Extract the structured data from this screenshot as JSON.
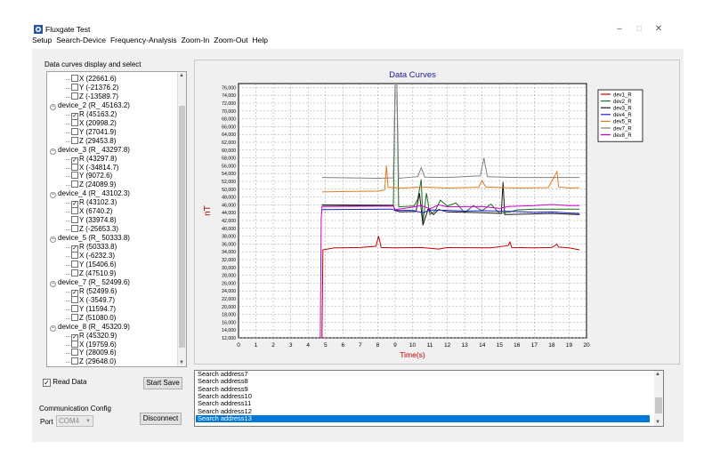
{
  "window": {
    "title": "Fluxgate Test"
  },
  "menu": [
    "Setup",
    "Search-Device",
    "Frequency-Analysis",
    "Zoom-In",
    "Zoom-Out",
    "Help"
  ],
  "tree_group_label": "Data curves display and select",
  "tree": [
    {
      "type": "leaf",
      "text": "X (22661.6)",
      "checked": false
    },
    {
      "type": "leaf",
      "text": "Y (-21376.2)",
      "checked": false
    },
    {
      "type": "leaf",
      "text": "Z (-13589.7)",
      "checked": false
    },
    {
      "type": "device",
      "text": "device_2  (R_ 45163.2)"
    },
    {
      "type": "leaf",
      "text": "R (45163.2)",
      "checked": true
    },
    {
      "type": "leaf",
      "text": "X (20998.2)",
      "checked": false
    },
    {
      "type": "leaf",
      "text": "Y (27041.9)",
      "checked": false
    },
    {
      "type": "leaf",
      "text": "Z (29453.8)",
      "checked": false
    },
    {
      "type": "device",
      "text": "device_3  (R_ 43297.8)"
    },
    {
      "type": "leaf",
      "text": "R (43297.8)",
      "checked": true
    },
    {
      "type": "leaf",
      "text": "X (-34814.7)",
      "checked": false
    },
    {
      "type": "leaf",
      "text": "Y (9072.6)",
      "checked": false
    },
    {
      "type": "leaf",
      "text": "Z (24089.9)",
      "checked": false
    },
    {
      "type": "device",
      "text": "device_4  (R_ 43102.3)"
    },
    {
      "type": "leaf",
      "text": "R (43102.3)",
      "checked": true
    },
    {
      "type": "leaf",
      "text": "X (6740.2)",
      "checked": false
    },
    {
      "type": "leaf",
      "text": "Y (33974.8)",
      "checked": false
    },
    {
      "type": "leaf",
      "text": "Z (-25653.3)",
      "checked": false
    },
    {
      "type": "device",
      "text": "device_5  (R_ 50333.8)"
    },
    {
      "type": "leaf",
      "text": "R (50333.8)",
      "checked": true
    },
    {
      "type": "leaf",
      "text": "X (-6232.3)",
      "checked": false
    },
    {
      "type": "leaf",
      "text": "Y (15406.6)",
      "checked": false
    },
    {
      "type": "leaf",
      "text": "Z (47510.9)",
      "checked": false
    },
    {
      "type": "device",
      "text": "device_7  (R_ 52499.6)"
    },
    {
      "type": "leaf",
      "text": "R (52499.6)",
      "checked": true
    },
    {
      "type": "leaf",
      "text": "X (-3549.7)",
      "checked": false
    },
    {
      "type": "leaf",
      "text": "Y (11594.7)",
      "checked": false
    },
    {
      "type": "leaf",
      "text": "Z (51080.0)",
      "checked": false
    },
    {
      "type": "device",
      "text": "device_8  (R_ 45320.9)"
    },
    {
      "type": "leaf",
      "text": "R (45320.9)",
      "checked": true
    },
    {
      "type": "leaf",
      "text": "X (19759.6)",
      "checked": false
    },
    {
      "type": "leaf",
      "text": "Y (28009.6)",
      "checked": false
    },
    {
      "type": "leaf",
      "text": "Z (29648.0)",
      "checked": false
    }
  ],
  "controls": {
    "read_data_label": "Read Data",
    "read_data_checked": true,
    "start_save_label": "Start Save",
    "comm_group_label": "Communication Config",
    "port_label": "Port",
    "port_value": "COM4",
    "disconnect_label": "Disconnect"
  },
  "log": {
    "items": [
      "Search address7",
      "Search address8",
      "Search address9",
      "Search address10",
      "Search address11",
      "Search address12",
      "Search address13"
    ],
    "selected_index": 6
  },
  "chart_data": {
    "type": "line",
    "title": "Data Curves",
    "xlabel": "Time(s)",
    "ylabel": "nT",
    "xlim": [
      0,
      20
    ],
    "ylim": [
      12000,
      77000
    ],
    "x_ticks": [
      0,
      1,
      2,
      3,
      4,
      5,
      6,
      7,
      8,
      9,
      10,
      11,
      12,
      13,
      14,
      15,
      16,
      17,
      18,
      19,
      20
    ],
    "y_ticks": [
      12000,
      14000,
      16000,
      18000,
      20000,
      22000,
      24000,
      26000,
      28000,
      30000,
      32000,
      34000,
      36000,
      38000,
      40000,
      42000,
      44000,
      46000,
      48000,
      50000,
      52000,
      54000,
      56000,
      58000,
      60000,
      62000,
      64000,
      66000,
      68000,
      70000,
      72000,
      74000,
      76000
    ],
    "grid": true,
    "legend_position": "right",
    "series": [
      {
        "name": "dev1_R",
        "color": "#c00000",
        "points": [
          [
            4.8,
            12000
          ],
          [
            4.85,
            34500
          ],
          [
            5.5,
            35000
          ],
          [
            7,
            35100
          ],
          [
            7.9,
            35400
          ],
          [
            8.05,
            38000
          ],
          [
            8.2,
            35100
          ],
          [
            9,
            35000
          ],
          [
            10.5,
            35100
          ],
          [
            11.5,
            34700
          ],
          [
            12,
            35100
          ],
          [
            14.5,
            35000
          ],
          [
            15.5,
            35600
          ],
          [
            15.6,
            36500
          ],
          [
            15.7,
            35100
          ],
          [
            17,
            35000
          ],
          [
            18,
            35100
          ],
          [
            18.3,
            35900
          ],
          [
            18.4,
            35200
          ],
          [
            19,
            35000
          ],
          [
            19.6,
            34500
          ]
        ]
      },
      {
        "name": "dev2_R",
        "color": "#1f6b1f",
        "points": [
          [
            4.8,
            46000
          ],
          [
            8.9,
            45900
          ],
          [
            9.0,
            77000
          ],
          [
            9.1,
            77000
          ],
          [
            9.2,
            45500
          ],
          [
            10.1,
            45700
          ],
          [
            10.3,
            47500
          ],
          [
            10.5,
            52500
          ],
          [
            10.6,
            41500
          ],
          [
            10.8,
            49000
          ],
          [
            11,
            43500
          ],
          [
            11.3,
            44500
          ],
          [
            11.6,
            47200
          ],
          [
            12,
            45700
          ],
          [
            12.5,
            46500
          ],
          [
            13,
            44000
          ],
          [
            13.5,
            45800
          ],
          [
            14,
            44500
          ],
          [
            14.5,
            46200
          ],
          [
            15,
            43800
          ],
          [
            15.5,
            44100
          ],
          [
            16,
            44700
          ],
          [
            17,
            44900
          ],
          [
            19.6,
            44900
          ]
        ]
      },
      {
        "name": "dev3_R",
        "color": "#1a1a1a",
        "points": [
          [
            4.8,
            45900
          ],
          [
            8.9,
            45800
          ],
          [
            9.0,
            44500
          ],
          [
            9.3,
            44200
          ],
          [
            10.2,
            44300
          ],
          [
            10.4,
            49000
          ],
          [
            10.6,
            40800
          ],
          [
            10.9,
            45000
          ],
          [
            11.2,
            43500
          ],
          [
            11.5,
            44800
          ],
          [
            12,
            44200
          ],
          [
            14,
            44000
          ],
          [
            15.1,
            43800
          ],
          [
            15.2,
            51800
          ],
          [
            15.3,
            43500
          ],
          [
            16,
            43600
          ],
          [
            18,
            43800
          ],
          [
            19.6,
            43500
          ]
        ]
      },
      {
        "name": "dev4_R",
        "color": "#1c1cc8",
        "points": [
          [
            4.8,
            44800
          ],
          [
            8.8,
            44900
          ],
          [
            9,
            44600
          ],
          [
            10,
            44600
          ],
          [
            10.6,
            44000
          ],
          [
            11,
            44700
          ],
          [
            12,
            44600
          ],
          [
            13,
            44400
          ],
          [
            14,
            44500
          ],
          [
            16,
            44300
          ],
          [
            17,
            44100
          ],
          [
            18,
            44200
          ],
          [
            19,
            43900
          ],
          [
            19.6,
            43800
          ]
        ]
      },
      {
        "name": "dev5_R",
        "color": "#e07a20",
        "points": [
          [
            4.8,
            49300
          ],
          [
            6,
            49400
          ],
          [
            8,
            49500
          ],
          [
            8.4,
            49800
          ],
          [
            8.5,
            56000
          ],
          [
            8.6,
            50500
          ],
          [
            9.5,
            50300
          ],
          [
            10.5,
            50600
          ],
          [
            12,
            50300
          ],
          [
            13.8,
            50500
          ],
          [
            14,
            52200
          ],
          [
            14.2,
            50600
          ],
          [
            16,
            50300
          ],
          [
            17.8,
            50400
          ],
          [
            18.3,
            54500
          ],
          [
            18.4,
            50600
          ],
          [
            19,
            50300
          ],
          [
            19.6,
            50400
          ]
        ]
      },
      {
        "name": "dev7_R",
        "color": "#808080",
        "points": [
          [
            4.8,
            53000
          ],
          [
            8,
            52800
          ],
          [
            8.9,
            52900
          ],
          [
            9.0,
            77000
          ],
          [
            9.1,
            77000
          ],
          [
            9.2,
            52800
          ],
          [
            10.3,
            53200
          ],
          [
            10.5,
            55500
          ],
          [
            10.7,
            53100
          ],
          [
            12,
            53000
          ],
          [
            13.9,
            53400
          ],
          [
            14.1,
            58000
          ],
          [
            14.3,
            53200
          ],
          [
            16,
            53000
          ],
          [
            18,
            53000
          ],
          [
            19.6,
            53000
          ]
        ]
      },
      {
        "name": "dev8_R",
        "color": "#d000d0",
        "points": [
          [
            4.7,
            12000
          ],
          [
            4.75,
            42500
          ],
          [
            4.8,
            45600
          ],
          [
            8.9,
            45700
          ],
          [
            9,
            44800
          ],
          [
            10,
            45400
          ],
          [
            10.5,
            45800
          ],
          [
            11,
            45000
          ],
          [
            11.5,
            46000
          ],
          [
            12,
            45500
          ],
          [
            14,
            45600
          ],
          [
            15,
            45100
          ],
          [
            15.5,
            45600
          ],
          [
            17,
            45800
          ],
          [
            18,
            46100
          ],
          [
            19,
            45800
          ],
          [
            19.6,
            45800
          ]
        ]
      }
    ]
  }
}
